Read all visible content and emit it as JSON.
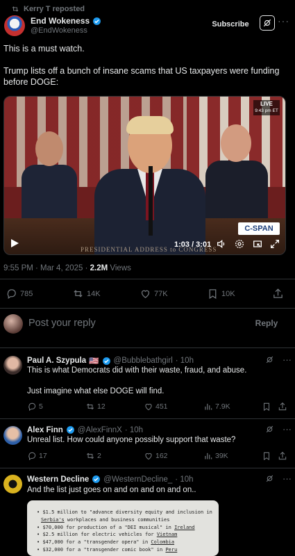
{
  "repost": {
    "label": "Kerry T reposted"
  },
  "author": {
    "name": "End Wokeness",
    "handle": "@EndWokeness"
  },
  "header": {
    "subscribe_label": "Subscribe",
    "more": "···"
  },
  "post": {
    "line1": "This is a must watch.",
    "line2": "Trump lists off a bunch of insane scams that US taxpayers were funding before DOGE:"
  },
  "video": {
    "live_label": "LIVE",
    "live_time": "9:43 pm ET",
    "network": "C-SPAN",
    "caption": "PRESIDENTIAL ADDRESS to CONGRESS",
    "time": "1:03 / 3:01"
  },
  "stamp": {
    "datetime": "9:55 PM · Mar 4, 2025 · ",
    "views": "2.2M",
    "views_label": " Views"
  },
  "actions": {
    "replies": "785",
    "reposts": "14K",
    "likes": "77K",
    "bookmarks": "10K"
  },
  "composer": {
    "placeholder": "Post your reply",
    "reply_label": "Reply"
  },
  "replies": [
    {
      "name": "Paul A. Szypula",
      "flag": "🇺🇸",
      "handle": "@Bubblebathgirl",
      "time": "· 10h",
      "text1": "This is what Democrats did with their waste, fraud, and abuse.",
      "text2": "Just imagine what else DOGE will find.",
      "replies": "5",
      "reposts": "12",
      "likes": "451",
      "views": "7.9K"
    },
    {
      "name": "Alex Finn",
      "handle": "@AlexFinnX",
      "time": "· 10h",
      "text1": "Unreal list. How could anyone possibly support that waste?",
      "replies": "17",
      "reposts": "2",
      "likes": "162",
      "views": "39K"
    },
    {
      "name": "Western Decline",
      "handle": "@WesternDecline_",
      "time": "· 10h",
      "text1": "And the list just goes on and on and on and on.."
    }
  ],
  "list_image": {
    "items": [
      {
        "pre": "$1.5 million to \"advance diversity equity and inclusion in",
        "place": ""
      },
      {
        "pre": "",
        "place": "Serbia's",
        "post": " workplaces and business communities"
      },
      {
        "pre": "$70,000 for production of a \"DEI musical\" in ",
        "place": "Ireland"
      },
      {
        "pre": "$2.5 million for electric vehicles for ",
        "place": "Vietnam"
      },
      {
        "pre": "$47,000 for a \"transgender opera\" in ",
        "place": "Colombia"
      },
      {
        "pre": "$32,000 for a \"transgender comic book\" in ",
        "place": "Peru"
      }
    ]
  },
  "colors": {
    "background": "#000000",
    "text": "#e7e9ea",
    "muted": "#71767b",
    "verified": "#1d9bf0",
    "divider": "#2f3336"
  }
}
